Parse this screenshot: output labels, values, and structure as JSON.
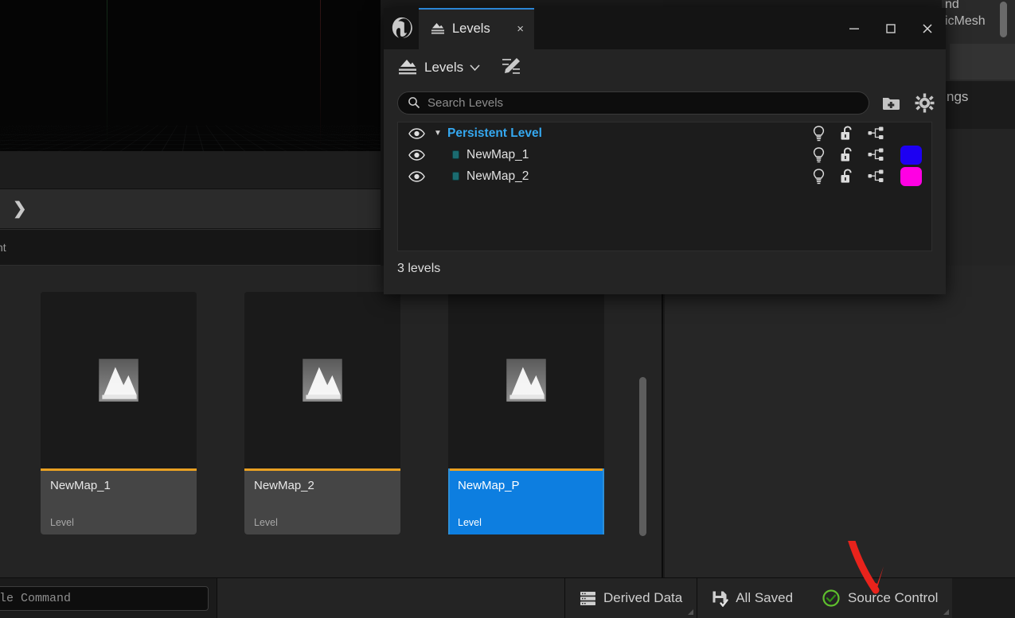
{
  "app": {
    "viewport_alt": "3d-perspective-grid-viewport",
    "expander_icon": "chevron-right-icon",
    "cut_label_left": "nt"
  },
  "right_panel_cut": {
    "line1": "nd",
    "line2": "icMesh",
    "line3": "ngs"
  },
  "levels_window": {
    "logo": "unreal-engine-logo",
    "tab": {
      "icon": "levels-icon",
      "label": "Levels",
      "close": "×"
    },
    "window_controls": {
      "minimize": "minimize-icon",
      "maximize": "maximize-icon",
      "close": "close-icon"
    },
    "toolbar": {
      "levels_menu_label": "Levels",
      "levels_menu_caret": "⌄",
      "edit_icon": "edit-pencil-icon"
    },
    "search": {
      "icon": "search-icon",
      "placeholder": "Search Levels"
    },
    "actions": {
      "new_folder_icon": "new-folder-icon",
      "settings_icon": "gear-icon"
    },
    "column_icons": {
      "visibility": "eye-icon",
      "lighting": "lightbulb-icon",
      "lock": "unlocked-padlock-icon",
      "hierarchy": "node-hierarchy-icon"
    },
    "rows": [
      {
        "name": "Persistent Level",
        "type": "persistent",
        "expander": "▼",
        "visible": true,
        "color": null
      },
      {
        "name": "NewMap_1",
        "type": "sublevel",
        "expander": "",
        "visible": true,
        "color": "#1d00f2"
      },
      {
        "name": "NewMap_2",
        "type": "sublevel",
        "expander": "",
        "visible": true,
        "color": "#ff00e3"
      }
    ],
    "footer": "3 levels"
  },
  "content_browser": {
    "tiles": [
      {
        "name": "NewMap_1",
        "type": "Level",
        "selected": false,
        "thumb": "level-mountain-icon"
      },
      {
        "name": "NewMap_2",
        "type": "Level",
        "selected": false,
        "thumb": "level-mountain-icon"
      },
      {
        "name": "NewMap_P",
        "type": "Level",
        "selected": true,
        "thumb": "level-mountain-icon"
      }
    ],
    "accent_color": "#e8a022",
    "selection_color": "#0d7ee0"
  },
  "status_bar": {
    "command_placeholder": "le  Command",
    "derived_data": {
      "icon": "server-rack-icon",
      "label": "Derived Data"
    },
    "all_saved": {
      "icon": "save-check-icon",
      "label": "All Saved"
    },
    "source_control": {
      "icon": "green-check-circle-icon",
      "label": "Source Control"
    }
  },
  "annotation": {
    "arrow": "red-arrow-pointing-to-source-control",
    "color": "#e8231c"
  }
}
